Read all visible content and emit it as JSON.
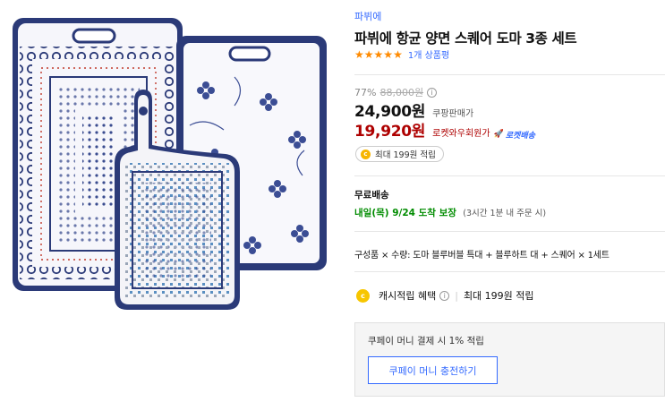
{
  "product": {
    "brand": "파뷔에",
    "title": "파뷔에 항균 양면 스퀘어 도마 3종 세트",
    "rating_stars": 5,
    "star_glyph": "★",
    "review_count": "1개 상품평"
  },
  "price": {
    "discount_rate": "77%",
    "base_price": "88,000원",
    "info_icon": "i",
    "sale_price": "24,900원",
    "sale_label": "쿠팡판매가",
    "member_price": "19,920원",
    "member_label": "로켓와우회원가",
    "rocket_icon": "🚀",
    "rocket_badge": "로켓배송"
  },
  "reward": {
    "coin_icon": "c",
    "text": "최대 199원 적립"
  },
  "shipping": {
    "title": "무료배송",
    "delivery_date": "내일(목) 9/24 도착 보장",
    "delivery_note": "(3시간 1분 내 주문 시)"
  },
  "option": {
    "text": "구성품 × 수량: 도마 블루버블 특대 + 블루하트 대 + 스퀘어 × 1세트"
  },
  "cash": {
    "coin_icon": "c",
    "label": "캐시적립 혜택",
    "info_icon": "i",
    "separator": "|",
    "amount": "최대 199원 적립"
  },
  "coupay": {
    "text": "쿠페이 머니 결제 시 1% 적립",
    "button_label": "쿠페이 머니 충전하기"
  },
  "colors": {
    "accent_blue": "#346aff",
    "rocket_red": "#ae0000",
    "delivery_green": "#008c00",
    "star_orange": "#ff8a00",
    "board_navy": "#2b3a78"
  }
}
